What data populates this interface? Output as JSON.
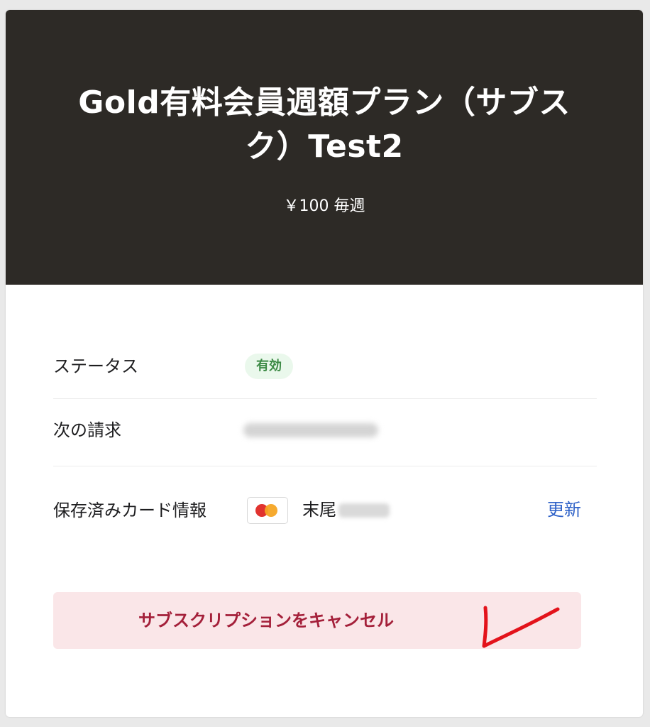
{
  "header": {
    "plan_title": "Gold有料会員週額プラン（サブスク）Test2",
    "plan_price": "￥100 毎週",
    "background_color": "#2d2a26"
  },
  "details": {
    "status_label": "ステータス",
    "status_value": "有効",
    "next_billing_label": "次の請求",
    "saved_card_label": "保存済みカード情報",
    "card_brand_icon": "mastercard-icon",
    "card_suffix_label": "末尾",
    "update_link": "更新"
  },
  "actions": {
    "cancel_label": "サブスクリプションをキャンセル",
    "cancel_color": "#a4203a"
  },
  "annotation": {
    "icon": "red-checkmark-annotation",
    "color": "#e3131b"
  }
}
